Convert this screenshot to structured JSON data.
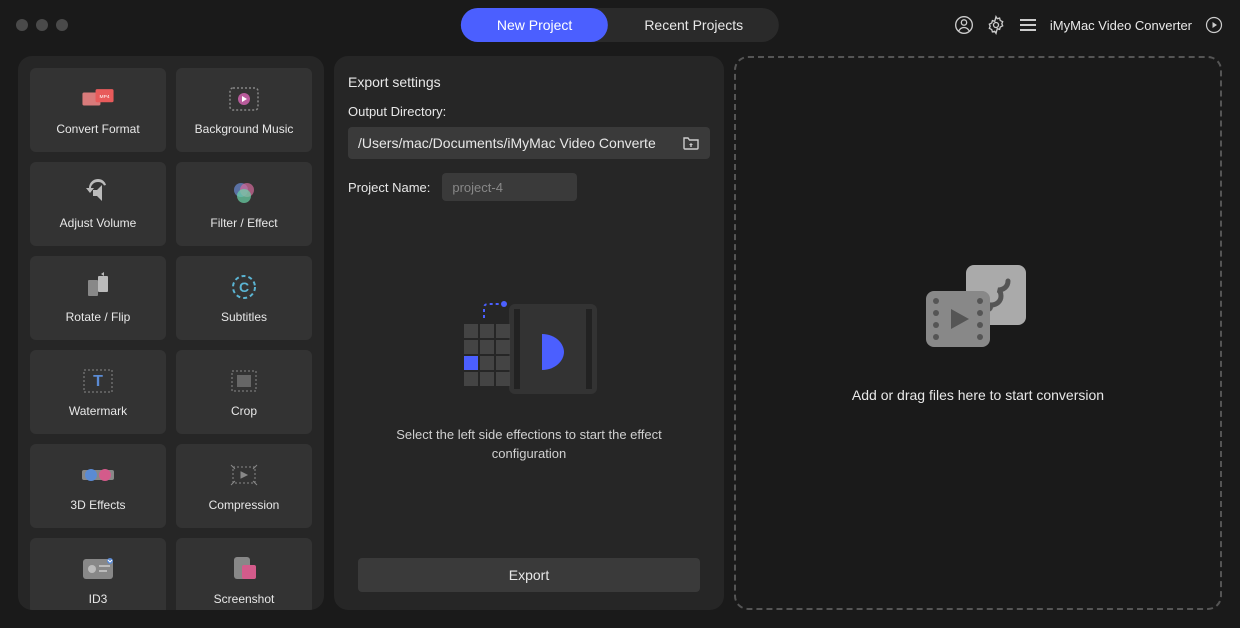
{
  "header": {
    "tabs": {
      "new_project": "New Project",
      "recent_projects": "Recent Projects"
    },
    "app_title": "iMyMac Video Converter"
  },
  "sidebar": {
    "tools": [
      {
        "label": "Convert Format"
      },
      {
        "label": "Background Music"
      },
      {
        "label": "Adjust Volume"
      },
      {
        "label": "Filter / Effect"
      },
      {
        "label": "Rotate / Flip"
      },
      {
        "label": "Subtitles"
      },
      {
        "label": "Watermark"
      },
      {
        "label": "Crop"
      },
      {
        "label": "3D Effects"
      },
      {
        "label": "Compression"
      },
      {
        "label": "ID3"
      },
      {
        "label": "Screenshot"
      }
    ]
  },
  "export": {
    "section_title": "Export settings",
    "output_dir_label": "Output Directory:",
    "output_dir_value": "/Users/mac/Documents/iMyMac Video Converte",
    "project_name_label": "Project Name:",
    "project_name_placeholder": "project-4",
    "instruction": "Select the left side effections to start the effect configuration",
    "export_button": "Export"
  },
  "dropzone": {
    "hint": "Add or drag files here to start conversion"
  }
}
